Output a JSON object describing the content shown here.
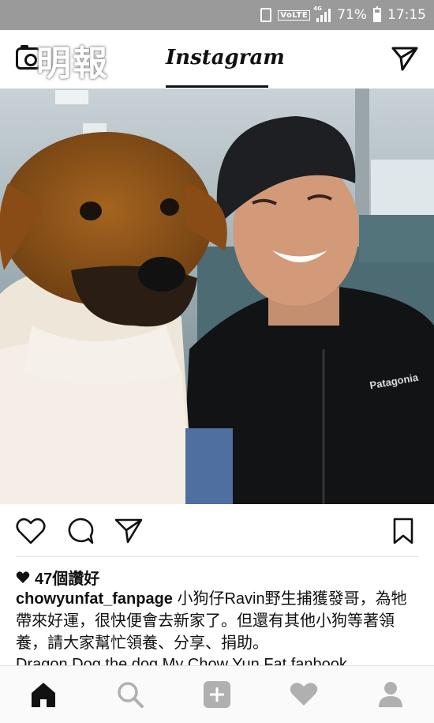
{
  "status_bar": {
    "network": "VoLTE",
    "network_type": "4G",
    "battery": "71%",
    "time": "17:15"
  },
  "header": {
    "watermark": "明報",
    "title": "Instagram"
  },
  "post": {
    "photo_subject": "Man in black cap holding a brown and white puppy on a ferry",
    "jacket_brand": "Patagonia",
    "likes": "47個讚好",
    "username": "chowyunfat_fanpage",
    "caption": "小狗仔Ravin野生捕獲發哥，為牠帶來好運，很快便會去新家了。但還有其他小狗等著領養，請大家幫忙領養、分享、捐助。",
    "caption_more": "Dragon Dog the dog My Chow Yun Fat fanbook ...",
    "actions": [
      "heart-icon",
      "comment-icon",
      "share-icon",
      "bookmark-icon"
    ]
  },
  "bottom_nav": [
    "home-icon",
    "search-icon",
    "add-icon",
    "activity-icon",
    "profile-icon"
  ],
  "colors": {
    "status_bar": "#9a9a9a",
    "icon": "#111111",
    "nav_inactive": "#b0b0b0"
  }
}
